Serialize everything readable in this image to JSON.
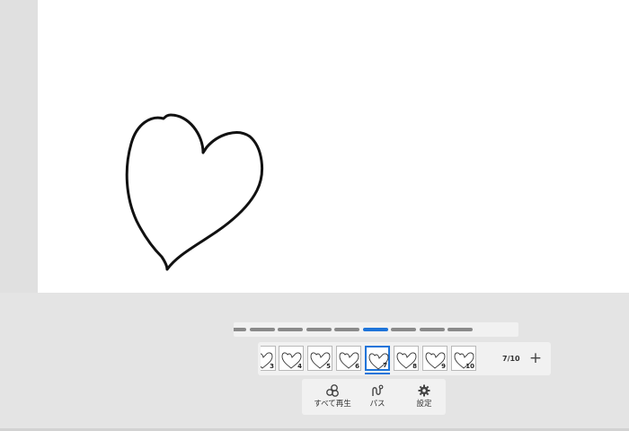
{
  "frames": [
    {
      "number": "3",
      "partial": true
    },
    {
      "number": "4"
    },
    {
      "number": "5"
    },
    {
      "number": "6"
    },
    {
      "number": "7",
      "current": true
    },
    {
      "number": "8"
    },
    {
      "number": "9"
    },
    {
      "number": "10"
    }
  ],
  "frame_counter": "7/10",
  "add_frame_symbol": "+",
  "timeline": {
    "segment_count": 9,
    "active_segment": 5
  },
  "actions": [
    {
      "label": "すべて再生",
      "icon": "play-all-icon"
    },
    {
      "label": "パス",
      "icon": "path-icon"
    },
    {
      "label": "設定",
      "icon": "gear-icon"
    }
  ],
  "colors": {
    "accent": "#1e74d9",
    "canvas": "#ffffff",
    "background": "#e4e4e4",
    "segment": "#8a8a8a"
  }
}
